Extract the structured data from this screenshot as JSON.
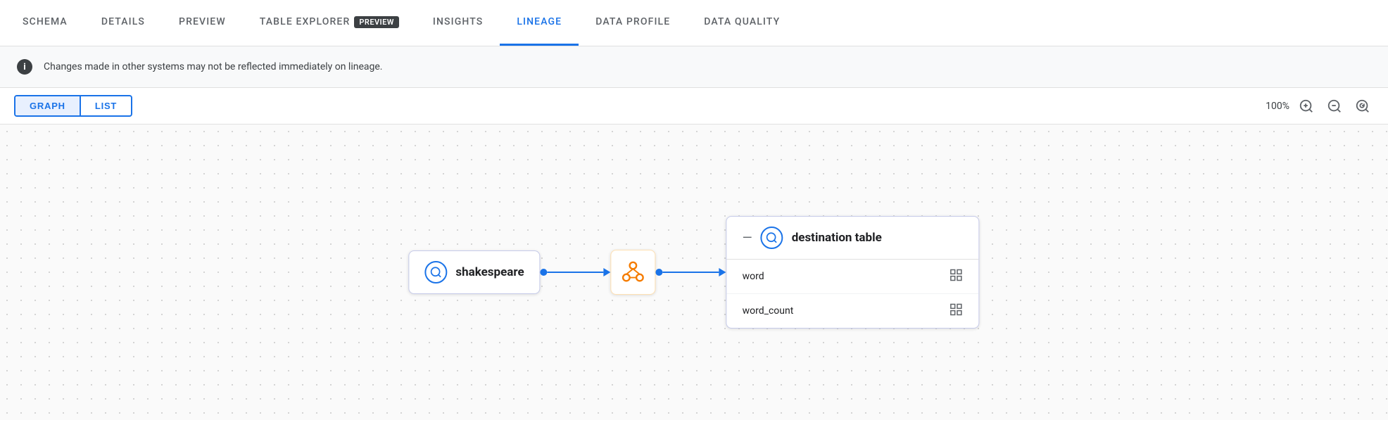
{
  "tabs": [
    {
      "id": "schema",
      "label": "SCHEMA",
      "active": false
    },
    {
      "id": "details",
      "label": "DETAILS",
      "active": false
    },
    {
      "id": "preview",
      "label": "PREVIEW",
      "active": false
    },
    {
      "id": "table-explorer",
      "label": "TABLE EXPLORER",
      "active": false,
      "badge": "PREVIEW"
    },
    {
      "id": "insights",
      "label": "INSIGHTS",
      "active": false
    },
    {
      "id": "lineage",
      "label": "LINEAGE",
      "active": true
    },
    {
      "id": "data-profile",
      "label": "DATA PROFILE",
      "active": false
    },
    {
      "id": "data-quality",
      "label": "DATA QUALITY",
      "active": false
    }
  ],
  "banner": {
    "text": "Changes made in other systems may not be reflected immediately on lineage."
  },
  "toolbar": {
    "graph_label": "GRAPH",
    "list_label": "LIST",
    "zoom_level": "100%"
  },
  "graph": {
    "source_node": {
      "label": "shakespeare"
    },
    "destination_node": {
      "label": "destination table",
      "fields": [
        {
          "name": "word"
        },
        {
          "name": "word_count"
        }
      ]
    }
  }
}
